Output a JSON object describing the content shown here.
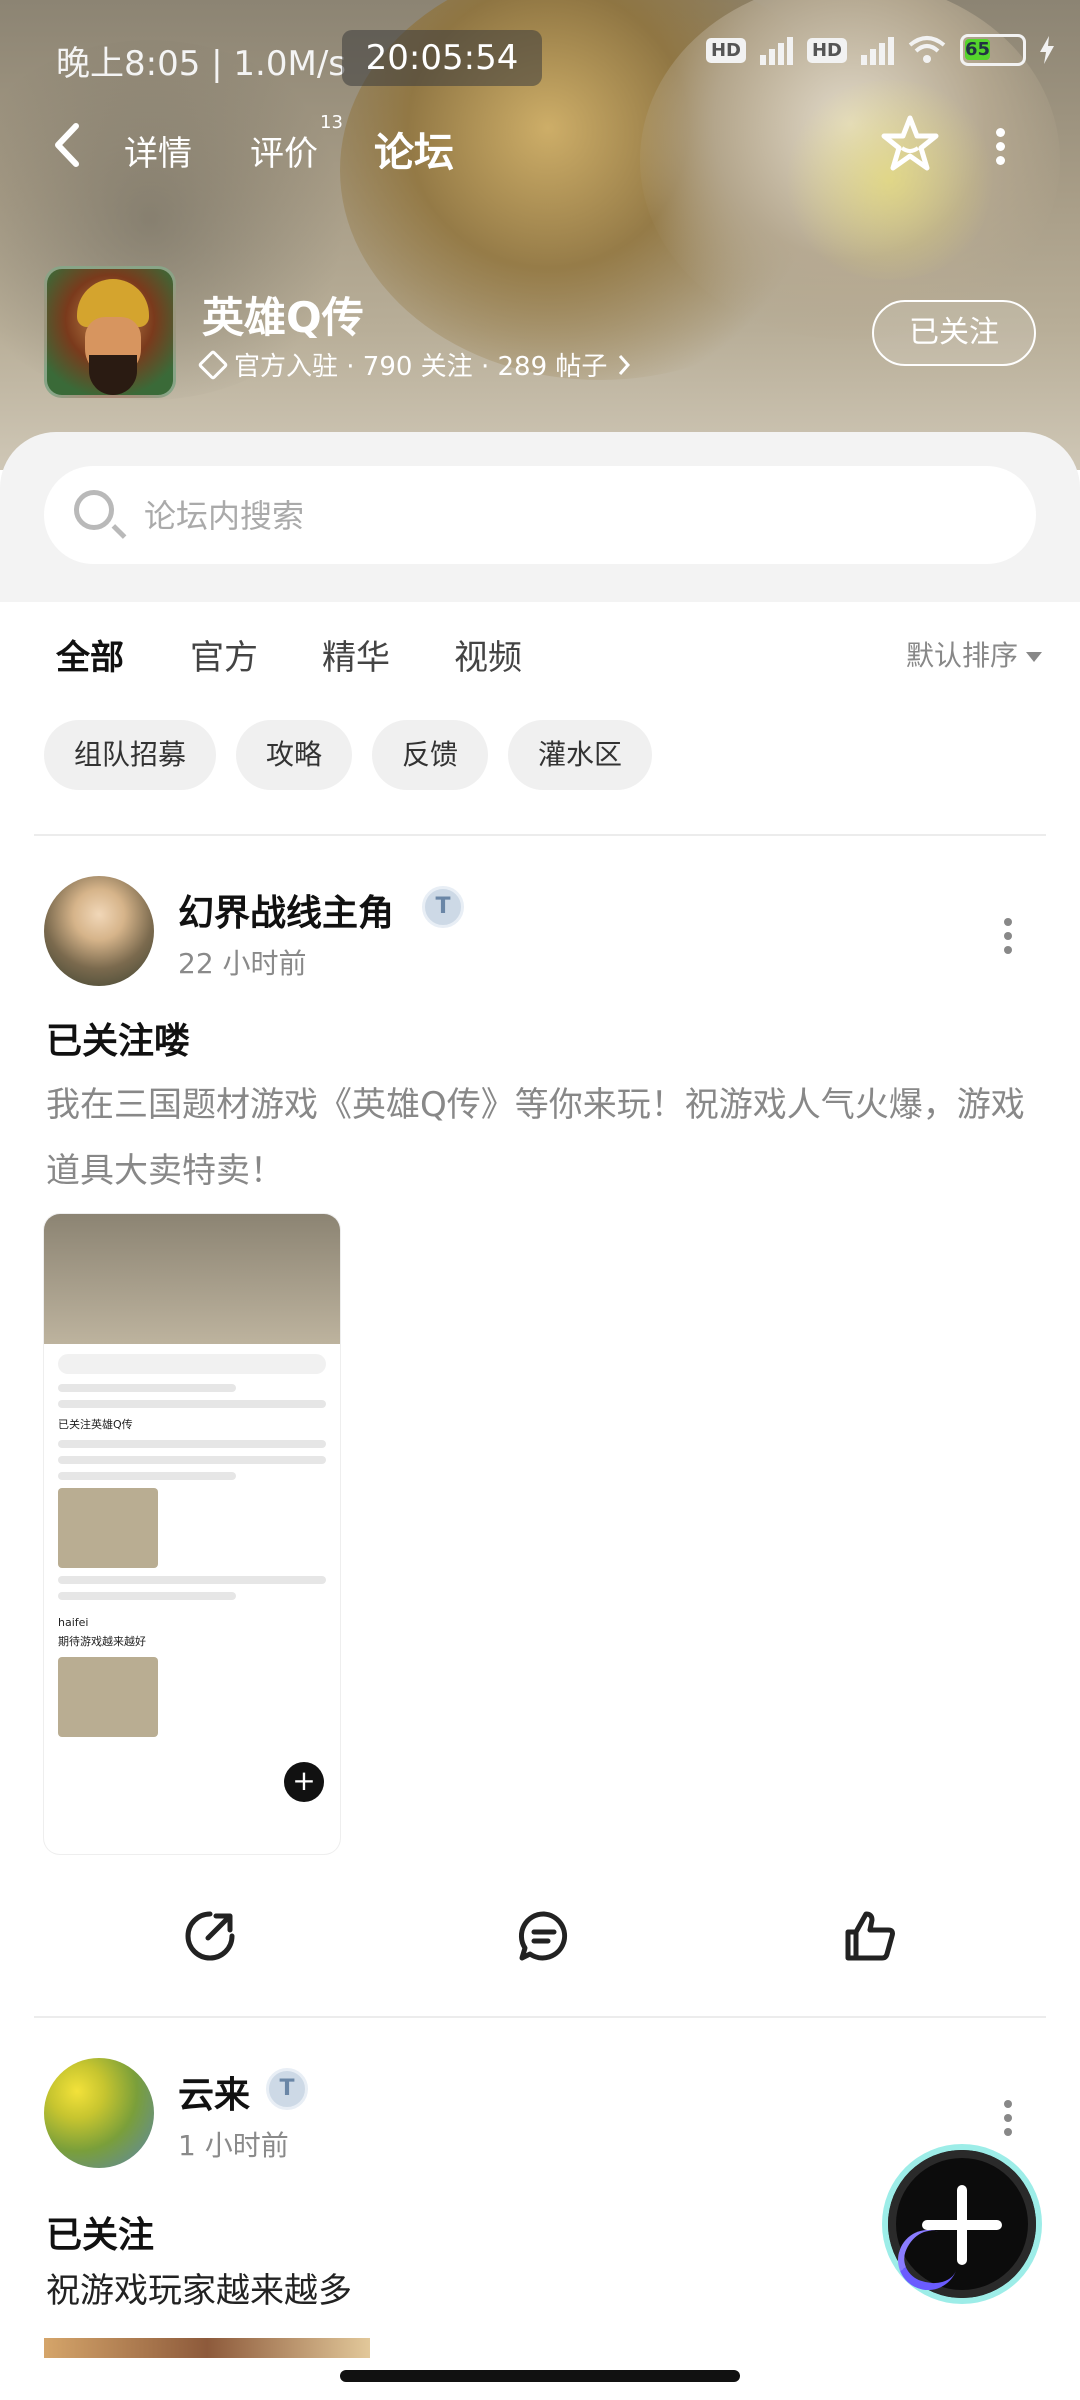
{
  "status_bar": {
    "time_text": "晚上8:05 | 1.0M/s",
    "clock": "20:05:54",
    "sim1": "HD",
    "sim2": "HD",
    "battery": "65"
  },
  "nav": {
    "tabs": [
      "详情",
      "评价",
      "论坛"
    ],
    "review_count": "13",
    "active_tab": "论坛"
  },
  "game": {
    "name": "英雄Q传",
    "meta": "官方入驻 · 790 关注 · 289 帖子",
    "follow_label": "已关注"
  },
  "search": {
    "placeholder": "论坛内搜索"
  },
  "filters": {
    "tabs": [
      "全部",
      "官方",
      "精华",
      "视频"
    ],
    "sort_label": "默认排序",
    "chips": [
      "组队招募",
      "攻略",
      "反馈",
      "灌水区"
    ]
  },
  "posts": [
    {
      "username": "幻界战线主角",
      "badge": "T",
      "time": "22 小时前",
      "title": "已关注喽",
      "body": "我在三国题材游戏《英雄Q传》等你来玩！祝游戏人气火爆，游戏道具大卖特卖！"
    },
    {
      "username": "云来",
      "badge": "T",
      "time": "1 小时前",
      "title": "已关注",
      "body": "祝游戏玩家越来越多"
    }
  ],
  "post_image": {
    "title": "已关注英雄Q传",
    "user2": "haifei",
    "caption2": "期待游戏越来越好"
  },
  "icons": {
    "share": "share-icon",
    "comment": "comment-icon",
    "like": "thumbs-up-icon",
    "add": "plus-icon"
  },
  "colors": {
    "accent": "#27cbc0"
  }
}
